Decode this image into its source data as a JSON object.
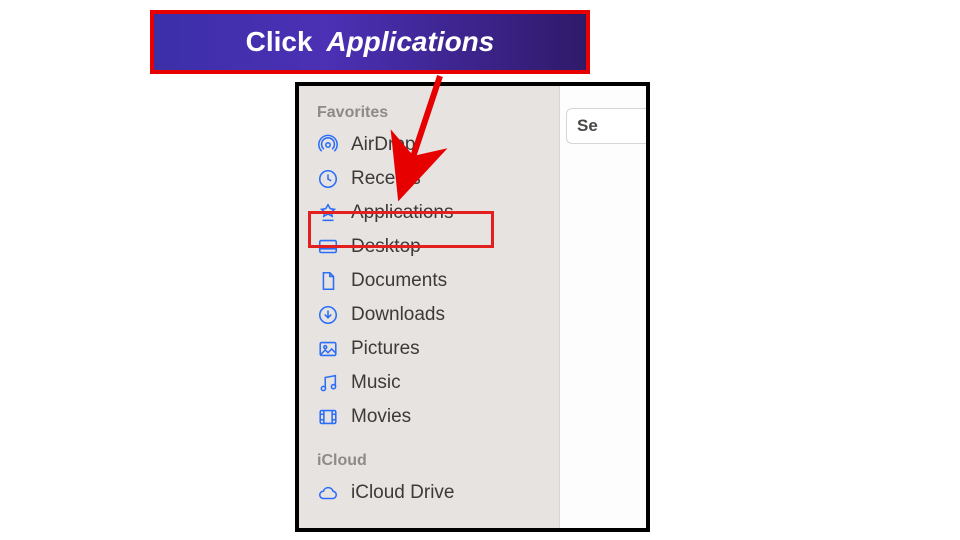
{
  "callout": {
    "prefix": "Click",
    "target": "Applications"
  },
  "sidebar": {
    "sections": {
      "favorites": {
        "header": "Favorites",
        "items": [
          {
            "label": "AirDrop"
          },
          {
            "label": "Recents"
          },
          {
            "label": "Applications"
          },
          {
            "label": "Desktop"
          },
          {
            "label": "Documents"
          },
          {
            "label": "Downloads"
          },
          {
            "label": "Pictures"
          },
          {
            "label": "Music"
          },
          {
            "label": "Movies"
          }
        ]
      },
      "icloud": {
        "header": "iCloud",
        "items": [
          {
            "label": "iCloud Drive"
          }
        ]
      }
    }
  },
  "right_tab": {
    "label": "Se"
  }
}
